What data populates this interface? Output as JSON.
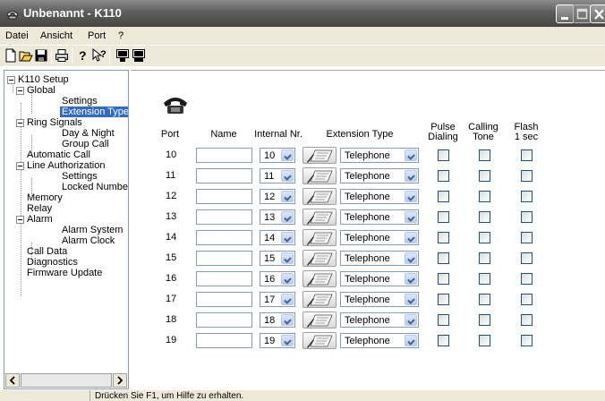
{
  "window": {
    "title": "Unbenannt - K110"
  },
  "menu": [
    "Datei",
    "Ansicht",
    "Port",
    "?"
  ],
  "toolbar_icons": [
    "new-icon",
    "open-icon",
    "save-icon",
    "print-icon",
    "help-icon",
    "context-help-icon",
    "connect-icon",
    "disconnect-icon"
  ],
  "tree": {
    "items": [
      {
        "label": "K110 Setup",
        "level": 0
      },
      {
        "label": "Global",
        "level": 1
      },
      {
        "label": "Settings",
        "level": 2
      },
      {
        "label": "Extension Type",
        "level": 2,
        "selected": true
      },
      {
        "label": "Ring Signals",
        "level": 1
      },
      {
        "label": "Day & Night",
        "level": 2
      },
      {
        "label": "Group Call",
        "level": 2
      },
      {
        "label": "Automatic Call",
        "level": 1
      },
      {
        "label": "Line Authorization",
        "level": 1
      },
      {
        "label": "Settings",
        "level": 2
      },
      {
        "label": "Locked Numbers",
        "level": 2
      },
      {
        "label": "Memory",
        "level": 1
      },
      {
        "label": "Relay",
        "level": 1
      },
      {
        "label": "Alarm",
        "level": 1
      },
      {
        "label": "Alarm System",
        "level": 2
      },
      {
        "label": "Alarm Clock",
        "level": 2
      },
      {
        "label": "Call Data",
        "level": 1
      },
      {
        "label": "Diagnostics",
        "level": 1
      },
      {
        "label": "Firmware Update",
        "level": 1
      }
    ]
  },
  "headers": {
    "port": "Port",
    "name": "Name",
    "internal": "Internal Nr.",
    "ext_type": "Extension Type",
    "pulse": [
      "Pulse",
      "Dialing"
    ],
    "calling": [
      "Calling",
      "Tone"
    ],
    "flash": [
      "Flash",
      "1 sec"
    ]
  },
  "rows": [
    {
      "port": "10",
      "name": "",
      "internal": "10",
      "type": "Telephone",
      "pulse": false,
      "calling": false,
      "flash": false
    },
    {
      "port": "11",
      "name": "",
      "internal": "11",
      "type": "Telephone",
      "pulse": false,
      "calling": false,
      "flash": false
    },
    {
      "port": "12",
      "name": "",
      "internal": "12",
      "type": "Telephone",
      "pulse": false,
      "calling": false,
      "flash": false
    },
    {
      "port": "13",
      "name": "",
      "internal": "13",
      "type": "Telephone",
      "pulse": false,
      "calling": false,
      "flash": false
    },
    {
      "port": "14",
      "name": "",
      "internal": "14",
      "type": "Telephone",
      "pulse": false,
      "calling": false,
      "flash": false
    },
    {
      "port": "15",
      "name": "",
      "internal": "15",
      "type": "Telephone",
      "pulse": false,
      "calling": false,
      "flash": false
    },
    {
      "port": "16",
      "name": "",
      "internal": "16",
      "type": "Telephone",
      "pulse": false,
      "calling": false,
      "flash": false
    },
    {
      "port": "17",
      "name": "",
      "internal": "17",
      "type": "Telephone",
      "pulse": false,
      "calling": false,
      "flash": false
    },
    {
      "port": "18",
      "name": "",
      "internal": "18",
      "type": "Telephone",
      "pulse": false,
      "calling": false,
      "flash": false
    },
    {
      "port": "19",
      "name": "",
      "internal": "19",
      "type": "Telephone",
      "pulse": false,
      "calling": false,
      "flash": false
    }
  ],
  "status": {
    "text": "Drücken Sie F1, um Hilfe zu erhalten."
  },
  "colors": {
    "selection": "#316ac5",
    "chrome": "#ece9d8",
    "titlebar": "#5d5d5d"
  }
}
